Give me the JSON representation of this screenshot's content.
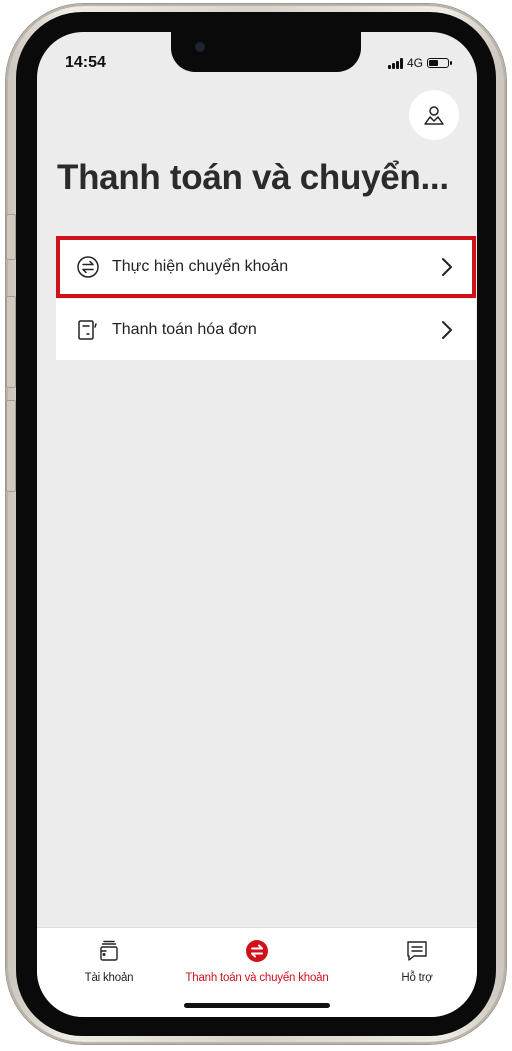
{
  "status_bar": {
    "time": "14:54",
    "network": "4G",
    "signal_icon": "signal-bars-icon",
    "battery_icon": "battery-icon"
  },
  "header": {
    "profile_icon": "user-icon",
    "title": "Thanh toán và chuyển..."
  },
  "menu": {
    "items": [
      {
        "label": "Thực hiện chuyển khoản",
        "icon": "transfer-arrows-icon",
        "highlighted": true
      },
      {
        "label": "Thanh toán hóa đơn",
        "icon": "bill-icon",
        "highlighted": false
      }
    ]
  },
  "tab_bar": {
    "tabs": [
      {
        "label": "Tài khoản",
        "icon": "wallet-icon",
        "active": false
      },
      {
        "label": "Thanh toán và chuyển khoản",
        "icon": "transfer-arrows-icon",
        "active": true
      },
      {
        "label": "Hỗ trợ",
        "icon": "chat-icon",
        "active": false
      }
    ]
  },
  "colors": {
    "accent": "#d0111a",
    "background": "#ececec",
    "card": "#ffffff",
    "text": "#222222"
  }
}
